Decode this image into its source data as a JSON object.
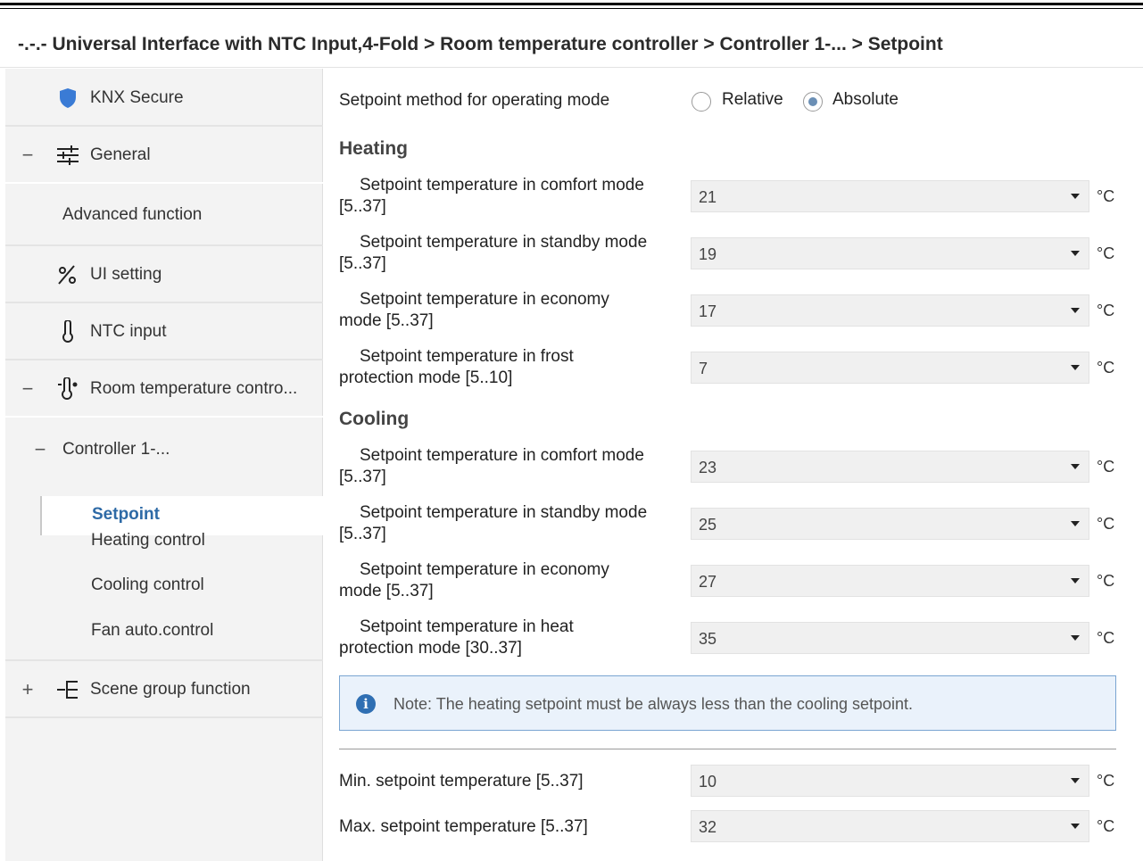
{
  "breadcrumb": "-.-.- Universal Interface with NTC Input,4-Fold > Room temperature controller > Controller 1-... > Setpoint",
  "sidebar": {
    "knx_secure": "KNX Secure",
    "general": "General",
    "advanced_function": "Advanced function",
    "ui_setting": "UI setting",
    "ntc_input": "NTC input",
    "room_temp": "Room temperature contro...",
    "controller": "Controller 1-...",
    "setpoint": "Setpoint",
    "heating_control": "Heating control",
    "cooling_control": "Cooling control",
    "fan_auto": "Fan auto.control",
    "scene_group": "Scene group function",
    "toggle_collapse": "−",
    "toggle_expand": "+"
  },
  "main": {
    "method_label": "Setpoint method for operating mode",
    "radio_relative": "Relative",
    "radio_absolute": "Absolute",
    "selected_method": "Absolute",
    "heating_title": "Heating",
    "cooling_title": "Cooling",
    "unit": "°C",
    "heating": [
      {
        "l1": "Setpoint temperature in comfort mode",
        "l2": "[5..37]",
        "value": "21"
      },
      {
        "l1": "Setpoint temperature in standby mode",
        "l2": "[5..37]",
        "value": "19"
      },
      {
        "l1": "Setpoint temperature in economy",
        "l2": "mode [5..37]",
        "value": "17"
      },
      {
        "l1": "Setpoint temperature in frost",
        "l2": "protection mode [5..10]",
        "value": "7"
      }
    ],
    "cooling": [
      {
        "l1": "Setpoint temperature in comfort mode",
        "l2": "[5..37]",
        "value": "23"
      },
      {
        "l1": "Setpoint temperature in standby mode",
        "l2": "[5..37]",
        "value": "25"
      },
      {
        "l1": "Setpoint temperature in economy",
        "l2": "mode [5..37]",
        "value": "27"
      },
      {
        "l1": "Setpoint temperature in heat",
        "l2": "protection mode [30..37]",
        "value": "35"
      }
    ],
    "note": "Note: The heating setpoint must be always less than the cooling setpoint.",
    "min_label": "Min. setpoint temperature [5..37]",
    "min_value": "10",
    "max_label": "Max. setpoint temperature [5..37]",
    "max_value": "32"
  },
  "colors": {
    "accent": "#2e6aa6",
    "sidebar_bg": "#f3f3f3",
    "select_bg": "#f0f0f0",
    "note_bg": "#eaf2fb",
    "note_border": "#7aa5d2"
  }
}
